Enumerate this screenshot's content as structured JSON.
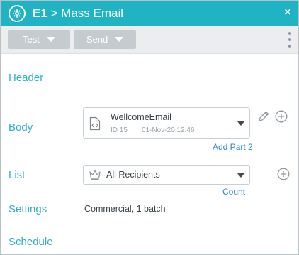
{
  "window": {
    "title_prefix": "E1",
    "title_rest": " > Mass Email",
    "close_glyph": "×",
    "accent_color": "#1fb3c4"
  },
  "toolbar": {
    "test_label": "Test",
    "send_label": "Send"
  },
  "sections": {
    "header_label": "Header",
    "body_label": "Body",
    "list_label": "List",
    "settings_label": "Settings",
    "schedule_label": "Schedule"
  },
  "body": {
    "email_name": "WellcomeEmail",
    "email_id": "ID 15",
    "email_date": "01-Nov-20 12:46",
    "add_part_label": "Add Part 2",
    "icon": "code-file-icon"
  },
  "list": {
    "selected": "All Recipients",
    "count_label": "Count",
    "icon": "crown-icon"
  },
  "settings": {
    "value": "Commercial, 1 batch"
  }
}
